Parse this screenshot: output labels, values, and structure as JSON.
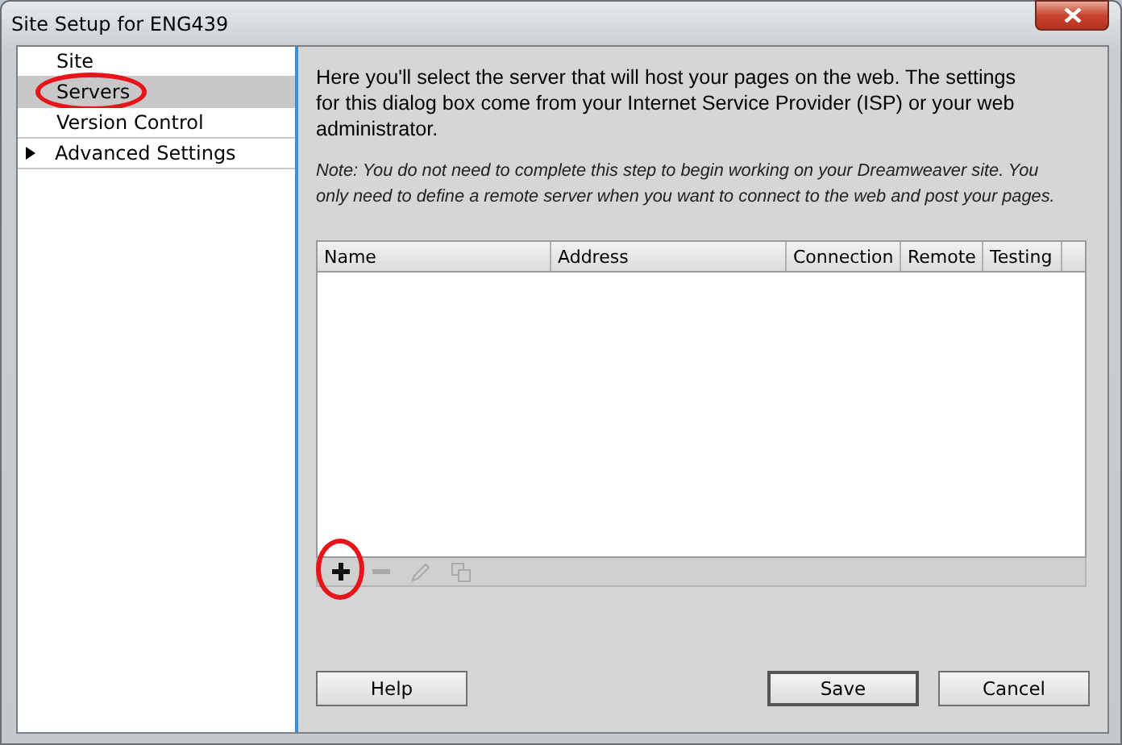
{
  "window": {
    "title": "Site Setup for ENG439"
  },
  "sidebar": {
    "items": [
      {
        "label": "Site",
        "kind": "item",
        "selected": false,
        "circled": false
      },
      {
        "label": "Servers",
        "kind": "item",
        "selected": true,
        "circled": true
      },
      {
        "label": "Version Control",
        "kind": "item",
        "selected": false,
        "circled": false
      },
      {
        "label": "Advanced Settings",
        "kind": "group",
        "selected": false,
        "expanded": false,
        "circled": false
      }
    ]
  },
  "intro": "Here you'll select the server that will host your pages on the web. The settings for this dialog box come from your Internet Service Provider (ISP) or your web administrator.",
  "note": "Note: You do not need to complete this step to begin working on your Dreamweaver site. You only need to define a remote server when you want to connect to the web and post your pages.",
  "table": {
    "columns": [
      "Name",
      "Address",
      "Connection",
      "Remote",
      "Testing"
    ]
  },
  "toolbar": [
    {
      "disabled": false,
      "circled": true
    },
    {
      "disabled": true,
      "circled": false
    },
    {
      "disabled": true,
      "circled": false
    },
    {
      "disabled": true,
      "circled": false
    }
  ],
  "buttons": [
    {
      "label": "Help",
      "default": false
    },
    {
      "label": "Save",
      "default": true
    },
    {
      "label": "Cancel",
      "default": false
    }
  ]
}
